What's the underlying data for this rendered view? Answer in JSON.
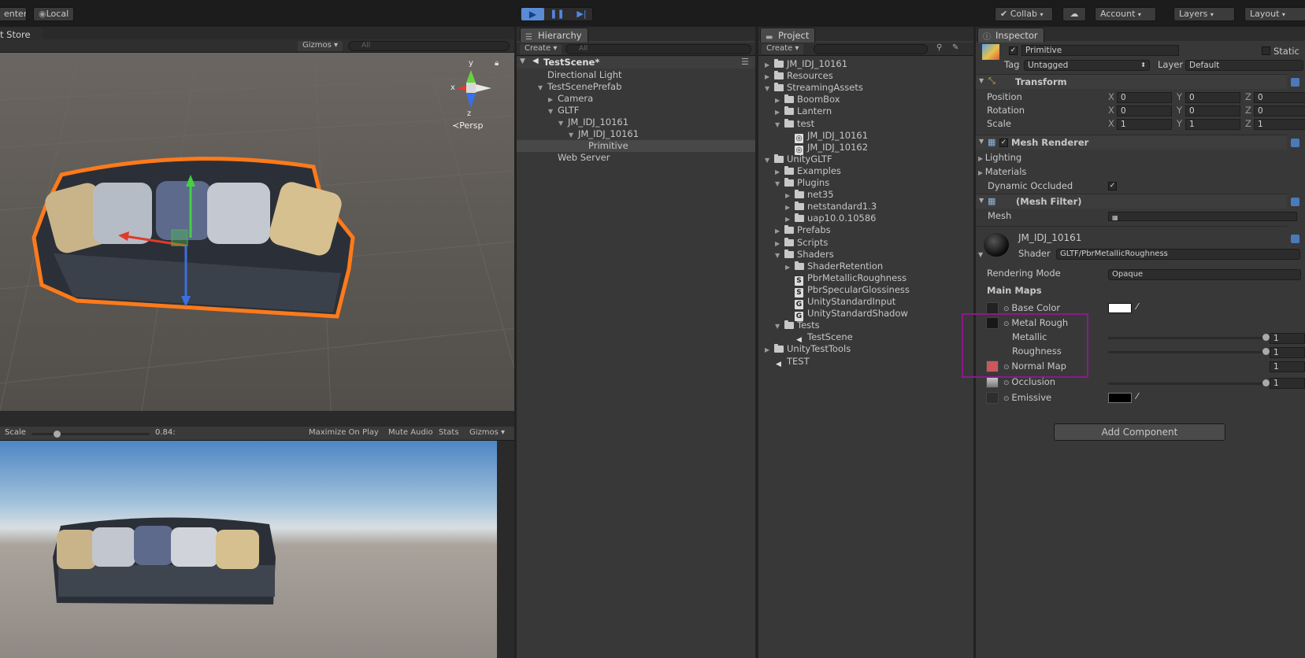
{
  "toolbar": {
    "center": "enter",
    "local": "Local",
    "collab": "✔ Collab",
    "account": "Account",
    "layers": "Layers",
    "layout": "Layout"
  },
  "scene": {
    "tab": "t Store",
    "gizmos": "Gizmos",
    "search_placeholder": "All",
    "persp": "Persp",
    "axis_y": "y",
    "axis_x": "x",
    "axis_z": "z"
  },
  "game": {
    "scale_label": "Scale",
    "scale_value": "0.84:",
    "maximize": "Maximize On Play",
    "mute": "Mute Audio",
    "stats": "Stats",
    "gizmos": "Gizmos"
  },
  "hierarchy": {
    "tab": "Hierarchy",
    "create": "Create",
    "search_placeholder": "All",
    "scene": "TestScene*",
    "items": [
      {
        "label": "Directional Light",
        "indent": 1,
        "arrow": ""
      },
      {
        "label": "TestScenePrefab",
        "indent": 1,
        "arrow": "▼"
      },
      {
        "label": "Camera",
        "indent": 2,
        "arrow": "▶"
      },
      {
        "label": "GLTF",
        "indent": 2,
        "arrow": "▼"
      },
      {
        "label": "JM_IDJ_10161",
        "indent": 3,
        "arrow": "▼"
      },
      {
        "label": "JM_IDJ_10161",
        "indent": 4,
        "arrow": "▼"
      },
      {
        "label": "Primitive",
        "indent": 5,
        "arrow": ""
      },
      {
        "label": "Web Server",
        "indent": 2,
        "arrow": ""
      }
    ]
  },
  "project": {
    "tab": "Project",
    "create": "Create",
    "items": [
      {
        "label": "JM_IDJ_10161",
        "indent": 0,
        "arrow": "▶",
        "kind": "folder"
      },
      {
        "label": "Resources",
        "indent": 0,
        "arrow": "▶",
        "kind": "folder"
      },
      {
        "label": "StreamingAssets",
        "indent": 0,
        "arrow": "▼",
        "kind": "folder"
      },
      {
        "label": "BoomBox",
        "indent": 1,
        "arrow": "▶",
        "kind": "folder"
      },
      {
        "label": "Lantern",
        "indent": 1,
        "arrow": "▶",
        "kind": "folder"
      },
      {
        "label": "test",
        "indent": 1,
        "arrow": "▼",
        "kind": "folder"
      },
      {
        "label": "JM_IDJ_10161",
        "indent": 2,
        "arrow": "",
        "kind": "asset"
      },
      {
        "label": "JM_IDJ_10162",
        "indent": 2,
        "arrow": "",
        "kind": "asset"
      },
      {
        "label": "UnityGLTF",
        "indent": 0,
        "arrow": "▼",
        "kind": "folder"
      },
      {
        "label": "Examples",
        "indent": 1,
        "arrow": "▶",
        "kind": "folder"
      },
      {
        "label": "Plugins",
        "indent": 1,
        "arrow": "▼",
        "kind": "folder"
      },
      {
        "label": "net35",
        "indent": 2,
        "arrow": "▶",
        "kind": "folder"
      },
      {
        "label": "netstandard1.3",
        "indent": 2,
        "arrow": "▶",
        "kind": "folder"
      },
      {
        "label": "uap10.0.10586",
        "indent": 2,
        "arrow": "▶",
        "kind": "folder"
      },
      {
        "label": "Prefabs",
        "indent": 1,
        "arrow": "▶",
        "kind": "folder"
      },
      {
        "label": "Scripts",
        "indent": 1,
        "arrow": "▶",
        "kind": "folder"
      },
      {
        "label": "Shaders",
        "indent": 1,
        "arrow": "▼",
        "kind": "folder"
      },
      {
        "label": "ShaderRetention",
        "indent": 2,
        "arrow": "▶",
        "kind": "folder"
      },
      {
        "label": "PbrMetallicRoughness",
        "indent": 2,
        "arrow": "",
        "kind": "shader"
      },
      {
        "label": "PbrSpecularGlossiness",
        "indent": 2,
        "arrow": "",
        "kind": "shader"
      },
      {
        "label": "UnityStandardInput",
        "indent": 2,
        "arrow": "",
        "kind": "include"
      },
      {
        "label": "UnityStandardShadow",
        "indent": 2,
        "arrow": "",
        "kind": "include"
      },
      {
        "label": "Tests",
        "indent": 1,
        "arrow": "▼",
        "kind": "folder"
      },
      {
        "label": "TestScene",
        "indent": 2,
        "arrow": "",
        "kind": "scene"
      },
      {
        "label": "UnityTestTools",
        "indent": 0,
        "arrow": "▶",
        "kind": "folder"
      },
      {
        "label": "TEST",
        "indent": 0,
        "arrow": "",
        "kind": "scene"
      }
    ]
  },
  "inspector": {
    "tab": "Inspector",
    "name": "Primitive",
    "static": "Static",
    "tag_label": "Tag",
    "tag": "Untagged",
    "layer_label": "Layer",
    "layer": "Default",
    "transform": {
      "title": "Transform",
      "position": "Position",
      "rotation": "Rotation",
      "scale": "Scale",
      "x": "X",
      "y": "Y",
      "z": "Z",
      "pos": [
        "0",
        "0",
        "0"
      ],
      "rot": [
        "0",
        "0",
        "0"
      ],
      "scl": [
        "1",
        "1",
        "1"
      ]
    },
    "mesh_renderer": {
      "title": "Mesh Renderer",
      "lighting": "Lighting",
      "materials": "Materials",
      "dynamic": "Dynamic Occluded"
    },
    "mesh_filter": {
      "title": "(Mesh Filter)",
      "mesh": "Mesh"
    },
    "material": {
      "name": "JM_IDJ_10161",
      "shader_label": "Shader",
      "shader": "GLTF/PbrMetallicRoughness",
      "rendering_mode_label": "Rendering Mode",
      "rendering_mode": "Opaque",
      "main_maps": "Main Maps",
      "base_color": "Base Color",
      "metal_rough": "Metal Rough",
      "metallic": "Metallic",
      "metallic_value": "1",
      "roughness": "Roughness",
      "roughness_value": "1",
      "normal_map": "Normal Map",
      "normal_value": "1",
      "occlusion": "Occlusion",
      "occlusion_value": "1",
      "emissive": "Emissive"
    },
    "add_component": "Add Component"
  },
  "colors": {
    "highlight": "#8b1a8b",
    "selection": "#ff7a1a"
  }
}
